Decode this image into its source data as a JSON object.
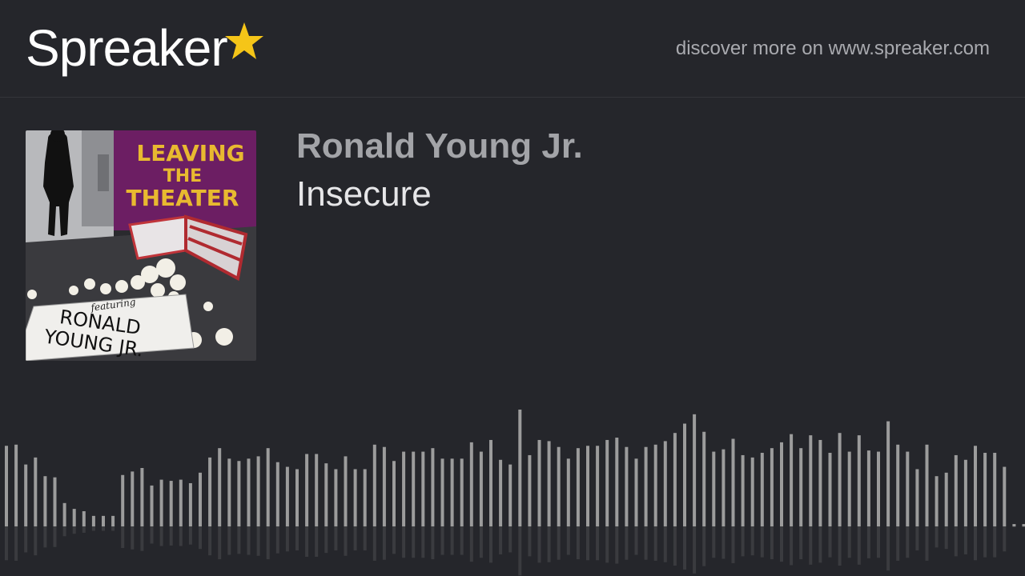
{
  "header": {
    "logo_text": "Spreaker",
    "logo_star_color": "#f5c518",
    "discover_text": "discover more on www.spreaker.com"
  },
  "cover": {
    "title_line1": "LEAVING",
    "title_line2": "THE",
    "title_line3": "THEATER",
    "featuring": "featuring",
    "name_line1": "RONALD",
    "name_line2": "YOUNG JR."
  },
  "episode": {
    "author": "Ronald Young Jr.",
    "title": "Insecure"
  },
  "waveform": {
    "bar_color": "#9c9c9c",
    "levels": [
      0.69,
      0.7,
      0.53,
      0.59,
      0.43,
      0.42,
      0.2,
      0.15,
      0.13,
      0.09,
      0.09,
      0.09,
      0.44,
      0.47,
      0.5,
      0.35,
      0.4,
      0.39,
      0.4,
      0.37,
      0.46,
      0.59,
      0.67,
      0.58,
      0.56,
      0.58,
      0.6,
      0.67,
      0.55,
      0.51,
      0.49,
      0.62,
      0.62,
      0.54,
      0.49,
      0.6,
      0.49,
      0.49,
      0.7,
      0.68,
      0.56,
      0.64,
      0.64,
      0.64,
      0.67,
      0.58,
      0.58,
      0.58,
      0.72,
      0.64,
      0.74,
      0.57,
      0.53,
      1.0,
      0.61,
      0.74,
      0.73,
      0.68,
      0.58,
      0.67,
      0.69,
      0.69,
      0.74,
      0.76,
      0.68,
      0.58,
      0.68,
      0.7,
      0.73,
      0.8,
      0.88,
      0.96,
      0.81,
      0.64,
      0.66,
      0.75,
      0.61,
      0.59,
      0.63,
      0.67,
      0.72,
      0.79,
      0.67,
      0.78,
      0.74,
      0.63,
      0.8,
      0.64,
      0.78,
      0.65,
      0.64,
      0.9,
      0.7,
      0.64,
      0.49,
      0.7,
      0.43,
      0.46,
      0.61,
      0.57,
      0.69,
      0.63,
      0.63,
      0.51,
      0.02,
      0.02
    ]
  }
}
